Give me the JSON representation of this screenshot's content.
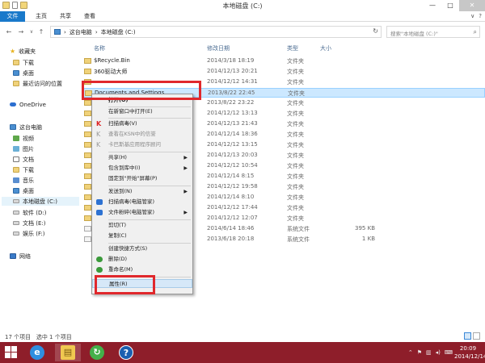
{
  "window": {
    "title": "本地磁盘 (C:)"
  },
  "ribbon": {
    "tabs": [
      "文件",
      "主页",
      "共享",
      "查看"
    ]
  },
  "address": {
    "path": [
      "这台电脑",
      "本地磁盘 (C:)"
    ],
    "search_placeholder": "搜索\"本地磁盘 (C:)\""
  },
  "nav": {
    "favorites": "收藏夹",
    "fav_items": [
      "下载",
      "桌面",
      "最近访问的位置"
    ],
    "onedrive": "OneDrive",
    "thispc": "这台电脑",
    "pc_items": [
      "视频",
      "图片",
      "文档",
      "下载",
      "音乐",
      "桌面"
    ],
    "drives": [
      "本地磁盘 (C:)",
      "软件 (D:)",
      "文档 (E:)",
      "娱乐 (F:)"
    ],
    "network": "网络"
  },
  "columns": {
    "name": "名称",
    "date": "修改日期",
    "type": "类型",
    "size": "大小"
  },
  "files": [
    {
      "name": "$Recycle.Bin",
      "date": "2014/3/18 18:19",
      "type": "文件夹",
      "size": ""
    },
    {
      "name": "360驱动大师",
      "date": "2014/12/13 20:21",
      "type": "文件夹",
      "size": ""
    },
    {
      "name": "",
      "date": "2014/12/12 14:31",
      "type": "文件夹",
      "size": ""
    },
    {
      "name": "Documents and Settings",
      "date": "2013/8/22 22:45",
      "type": "文件夹",
      "size": ""
    },
    {
      "name": "",
      "date": "2013/8/22 23:22",
      "type": "文件夹",
      "size": ""
    },
    {
      "name": "",
      "date": "2014/12/12 13:13",
      "type": "文件夹",
      "size": ""
    },
    {
      "name": "",
      "date": "2014/12/13 21:43",
      "type": "文件夹",
      "size": ""
    },
    {
      "name": "",
      "date": "2014/12/14 18:36",
      "type": "文件夹",
      "size": ""
    },
    {
      "name": "",
      "date": "2014/12/12 13:15",
      "type": "文件夹",
      "size": ""
    },
    {
      "name": "",
      "date": "2014/12/13 20:03",
      "type": "文件夹",
      "size": ""
    },
    {
      "name": "",
      "date": "2014/12/12 10:54",
      "type": "文件夹",
      "size": ""
    },
    {
      "name": "",
      "date": "2014/12/14 8:15",
      "type": "文件夹",
      "size": ""
    },
    {
      "name": "",
      "date": "2014/12/12 19:58",
      "type": "文件夹",
      "size": ""
    },
    {
      "name": "",
      "date": "2014/12/14 8:10",
      "type": "文件夹",
      "size": ""
    },
    {
      "name": "",
      "date": "2014/12/12 17:44",
      "type": "文件夹",
      "size": ""
    },
    {
      "name": "",
      "date": "2014/12/12 12:07",
      "type": "文件夹",
      "size": ""
    },
    {
      "name": "",
      "date": "2014/6/14 18:46",
      "type": "系统文件",
      "size": "395 KB"
    },
    {
      "name": "",
      "date": "2013/6/18 20:18",
      "type": "系统文件",
      "size": "1 KB"
    }
  ],
  "context_menu": {
    "open": "打开(O)",
    "open_new": "在新窗口中打开(E)",
    "scan": "扫描病毒(V)",
    "ksn": "查看在KSN中的信誉",
    "kasp": "卡巴斯基应用程序顾问",
    "share": "共享(H)",
    "include": "包含到库中(I)",
    "pin": "固定到\"开始\"屏幕(P)",
    "sendto": "发送到(N)",
    "scan2": "扫描病毒(电脑管家)",
    "shred": "文件粉碎(电脑管家)",
    "cut": "剪切(T)",
    "copy": "复制(C)",
    "shortcut": "创建快捷方式(S)",
    "delete": "删除(D)",
    "rename": "重命名(M)",
    "properties": "属性(R)"
  },
  "status": {
    "count": "17 个项目",
    "selected": "选中 1 个项目"
  },
  "taskbar": {
    "time": "20:09",
    "date": "2014/12/14"
  }
}
